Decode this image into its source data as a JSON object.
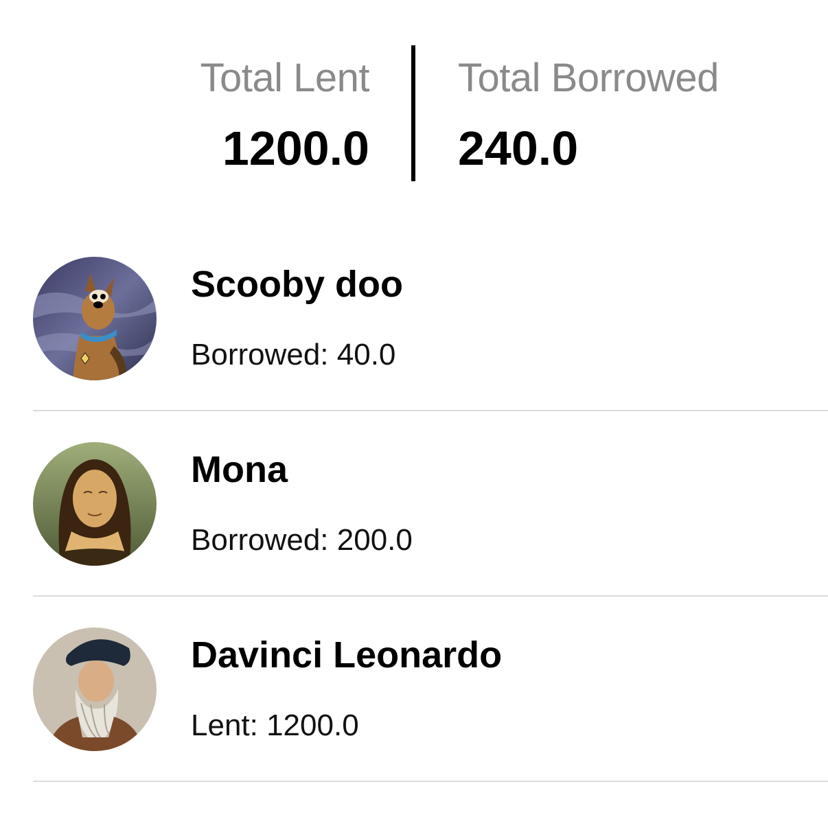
{
  "summary": {
    "lent_label": "Total Lent",
    "lent_value": "1200.0",
    "borrowed_label": "Total Borrowed",
    "borrowed_value": "240.0"
  },
  "contacts": [
    {
      "name": "Scooby doo",
      "detail": "Borrowed: 40.0",
      "avatar": "scooby-doo-avatar"
    },
    {
      "name": "Mona",
      "detail": "Borrowed: 200.0",
      "avatar": "mona-lisa-avatar"
    },
    {
      "name": "Davinci Leonardo",
      "detail": "Lent: 1200.0",
      "avatar": "leonardo-avatar"
    }
  ],
  "colors": {
    "label_gray": "#8a8a8a",
    "separator": "#dcdcdc",
    "text": "#000000"
  }
}
